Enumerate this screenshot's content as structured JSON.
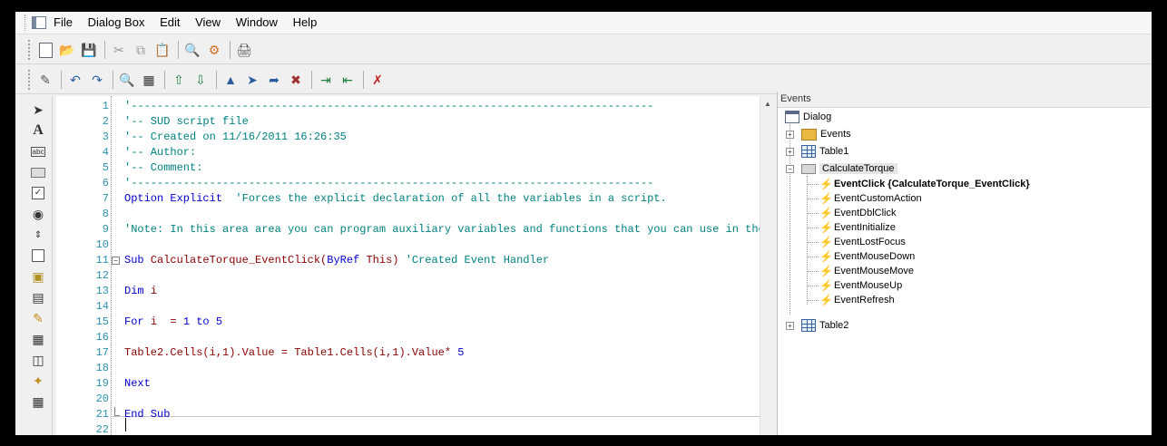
{
  "menu": [
    "File",
    "Dialog Box",
    "Edit",
    "View",
    "Window",
    "Help"
  ],
  "toolbar1_icons": [
    "new-icon",
    "open-icon",
    "save-icon",
    "cut-icon",
    "copy-icon",
    "paste-icon",
    "preview-icon",
    "run-icon",
    "print-icon"
  ],
  "toolbar2_icons": [
    "edit-icon",
    "undo-icon",
    "redo-icon",
    "find-icon",
    "replace-icon",
    "step-out-icon",
    "step-into-icon",
    "bookmark-icon",
    "next-bookmark-icon",
    "prev-bookmark-icon",
    "clear-bookmarks-icon",
    "indent-icon",
    "outdent-icon",
    "delete-icon"
  ],
  "toolbox_icons": [
    "pointer-icon",
    "text-icon",
    "label-icon",
    "button-icon",
    "checkbox-icon",
    "radio-icon",
    "spinner-icon",
    "frame-icon",
    "image-icon",
    "list-icon",
    "edit-icon",
    "chart-icon",
    "table-icon",
    "property-icon",
    "grid-icon"
  ],
  "editor": {
    "lines": [
      {
        "n": "1",
        "text": "'--------------------------------------------------------------------------------",
        "cls": "c-comment"
      },
      {
        "n": "2",
        "text": "'-- SUD script file",
        "cls": "c-comment"
      },
      {
        "n": "3",
        "text": "'-- Created on 11/16/2011 16:26:35",
        "cls": "c-comment"
      },
      {
        "n": "4",
        "text": "'-- Author:",
        "cls": "c-comment"
      },
      {
        "n": "5",
        "text": "'-- Comment:",
        "cls": "c-comment"
      },
      {
        "n": "6",
        "text": "'--------------------------------------------------------------------------------",
        "cls": "c-comment"
      },
      {
        "n": "7",
        "parts": [
          [
            "c-kw",
            "Option Explicit"
          ],
          [
            "c-comment",
            "  'Forces the explicit declaration of all the variables in a script."
          ]
        ]
      },
      {
        "n": "8",
        "text": "",
        "cls": ""
      },
      {
        "n": "9",
        "text": "'Note: In this area area you can program auxiliary variables and functions that you can use in the e",
        "cls": "c-comment"
      },
      {
        "n": "10",
        "text": "",
        "cls": ""
      },
      {
        "n": "11",
        "fold": "start",
        "parts": [
          [
            "c-kw",
            "Sub "
          ],
          [
            "c-code",
            "CalculateTorque_EventClick("
          ],
          [
            "c-kw",
            "ByRef "
          ],
          [
            "c-code",
            "This) "
          ],
          [
            "c-comment",
            "'Created Event Handler"
          ]
        ]
      },
      {
        "n": "12",
        "text": "",
        "cls": ""
      },
      {
        "n": "13",
        "parts": [
          [
            "c-kw",
            "Dim "
          ],
          [
            "c-code",
            "i"
          ]
        ]
      },
      {
        "n": "14",
        "text": "",
        "cls": ""
      },
      {
        "n": "15",
        "parts": [
          [
            "c-kw",
            "For "
          ],
          [
            "c-code",
            "i  = "
          ],
          [
            "c-num",
            "1 "
          ],
          [
            "c-kw",
            "to "
          ],
          [
            "c-num",
            "5"
          ]
        ]
      },
      {
        "n": "16",
        "text": "",
        "cls": ""
      },
      {
        "n": "17",
        "parts": [
          [
            "c-code",
            "Table2.Cells(i,1).Value = Table1.Cells(i,1).Value* "
          ],
          [
            "c-num",
            "5"
          ]
        ]
      },
      {
        "n": "18",
        "text": "",
        "cls": ""
      },
      {
        "n": "19",
        "parts": [
          [
            "c-kw",
            "Next"
          ]
        ]
      },
      {
        "n": "20",
        "text": "",
        "cls": ""
      },
      {
        "n": "21",
        "fold": "end",
        "parts": [
          [
            "c-kw",
            "End Sub"
          ]
        ]
      },
      {
        "n": "22",
        "text": "",
        "cls": ""
      }
    ]
  },
  "events_panel": {
    "title": "Events",
    "root": "Dialog",
    "events_node": "Events",
    "table1": "Table1",
    "calc": "CalculateTorque",
    "event_click": "EventClick {CalculateTorque_EventClick}",
    "items": [
      "EventCustomAction",
      "EventDblClick",
      "EventInitialize",
      "EventLostFocus",
      "EventMouseDown",
      "EventMouseMove",
      "EventMouseUp",
      "EventRefresh"
    ],
    "table2": "Table2"
  }
}
